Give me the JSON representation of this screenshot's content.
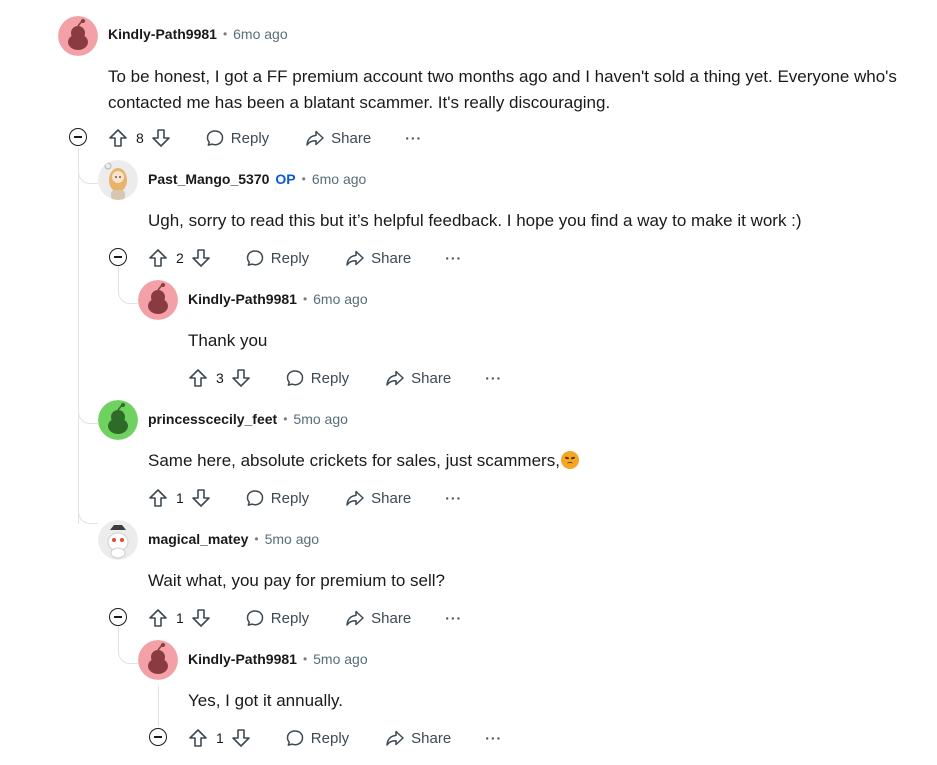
{
  "comments": [
    {
      "author": "Kindly-Path9981",
      "op_badge": "",
      "time": "6mo ago",
      "body_lines": [
        "To be honest, I got a FF premium account two months ago and I haven't sold a thing yet. Everyone who's",
        "contacted me has been a blatant scammer. It's really discouraging."
      ],
      "score": "8",
      "avatar_color": "#f3a0a6"
    },
    {
      "author": "Past_Mango_5370",
      "op_badge": "OP",
      "time": "6mo ago",
      "body_lines": [
        "Ugh, sorry to read this but it’s helpful feedback. I hope you find a way to make it work :)"
      ],
      "score": "2",
      "avatar_color": "#e8e8e8"
    },
    {
      "author": "Kindly-Path9981",
      "op_badge": "",
      "time": "6mo ago",
      "body_lines": [
        "Thank you"
      ],
      "score": "3",
      "avatar_color": "#f3a0a6"
    },
    {
      "author": "princesscecily_feet",
      "op_badge": "",
      "time": "5mo ago",
      "body_lines": [
        "Same here, absolute crickets for sales, just scammers,"
      ],
      "score": "1",
      "avatar_color": "#6fd15f"
    },
    {
      "author": "magical_matey",
      "op_badge": "",
      "time": "5mo ago",
      "body_lines": [
        "Wait what, you pay for premium to sell?"
      ],
      "score": "1",
      "avatar_color": "#e8e8e8"
    },
    {
      "author": "Kindly-Path9981",
      "op_badge": "",
      "time": "5mo ago",
      "body_lines": [
        "Yes, I got it annually."
      ],
      "score": "1",
      "avatar_color": "#f3a0a6"
    }
  ],
  "actions": {
    "reply_label": "Reply",
    "share_label": "Share",
    "more_label": "···",
    "separator": "•"
  },
  "icons": {
    "upvote": "upvote-icon",
    "downvote": "downvote-icon",
    "reply": "speech-bubble-icon",
    "share": "share-arrow-icon",
    "more": "more-icon",
    "collapse": "collapse-icon",
    "emoji": "disappointed-face-emoji"
  }
}
